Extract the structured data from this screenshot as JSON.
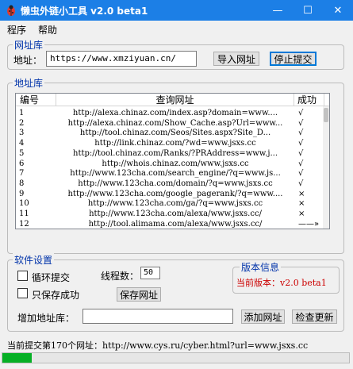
{
  "window": {
    "title": "懒虫外链小工具 v2.0 beta1",
    "controls": [
      "—",
      "☐",
      "✕"
    ]
  },
  "menu": [
    "程序",
    "帮助"
  ],
  "url_group": {
    "title": "网址库",
    "label": "地址：",
    "value": "https://www.xmziyuan.cn/",
    "import_button": "导入网址",
    "stop_button": "停止提交"
  },
  "list_group": {
    "title": "地址库",
    "columns": [
      "编号",
      "查询网址",
      "成功"
    ],
    "rows": [
      {
        "id": "1",
        "url": "http://alexa.chinaz.com/index.asp?domain=www....",
        "status": "√"
      },
      {
        "id": "2",
        "url": "http://alexa.chinaz.com/Show_Cache.asp?Url=www...",
        "status": "√"
      },
      {
        "id": "3",
        "url": "http://tool.chinaz.com/Seos/Sites.aspx?Site_D...",
        "status": "√"
      },
      {
        "id": "4",
        "url": "http://link.chinaz.com/?wd=www.jsxs.cc",
        "status": "√"
      },
      {
        "id": "5",
        "url": "http://tool.chinaz.com/Ranks/?PRAddress=www.j...",
        "status": "√"
      },
      {
        "id": "6",
        "url": "http://whois.chinaz.com/www.jsxs.cc",
        "status": "√"
      },
      {
        "id": "7",
        "url": "http://www.123cha.com/search_engine/?q=www.js...",
        "status": "√"
      },
      {
        "id": "8",
        "url": "http://www.123cha.com/domain/?q=www.jsxs.cc",
        "status": "√"
      },
      {
        "id": "9",
        "url": "http://www.123cha.com/google_pagerank/?q=www....",
        "status": "×"
      },
      {
        "id": "10",
        "url": "http://www.123cha.com/ga/?q=www.jsxs.cc",
        "status": "×"
      },
      {
        "id": "11",
        "url": "http://www.123cha.com/alexa/www.jsxs.cc/",
        "status": "×"
      },
      {
        "id": "12",
        "url": "http://tool.alimama.com/alexa/www.jsxs.cc/",
        "status": "——»"
      }
    ]
  },
  "settings_group": {
    "title": "软件设置",
    "loop_submit": "循环提交",
    "save_success_only": "只保存成功",
    "thread_label": "线程数：",
    "thread_value": "50",
    "save_button": "保存网址",
    "add_label": "增加地址库：",
    "add_value": "",
    "add_button": "添加网址",
    "check_update_button": "检查更新"
  },
  "version_group": {
    "title": "版本信息",
    "text": "当前版本：v2.0 beta1",
    "color": "#cc0000"
  },
  "status": {
    "text": "当前提交第170个网址：http://www.cys.ru/cyber.html?url=www.jsxs.cc",
    "progress": 0.085,
    "progress_color": "#06b025"
  },
  "colors": {
    "titlebar": "#1c7fe6",
    "group_title": "#0033aa"
  }
}
